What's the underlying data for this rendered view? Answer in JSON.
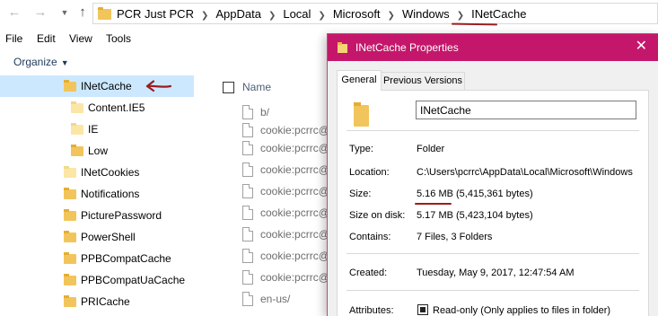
{
  "explorer": {
    "breadcrumbs": [
      "PCR Just PCR",
      "AppData",
      "Local",
      "Microsoft",
      "Windows",
      "INetCache"
    ],
    "menu": [
      "File",
      "Edit",
      "View",
      "Tools"
    ],
    "organize_label": "Organize",
    "nav_tree": [
      {
        "label": "INetCache",
        "selected": true,
        "pale": false
      },
      {
        "label": "Content.IE5",
        "selected": false,
        "pale": true
      },
      {
        "label": "IE",
        "selected": false,
        "pale": true
      },
      {
        "label": "Low",
        "selected": false,
        "pale": false
      },
      {
        "label": "INetCookies",
        "selected": false,
        "pale": true
      },
      {
        "label": "Notifications",
        "selected": false,
        "pale": false
      },
      {
        "label": "PicturePassword",
        "selected": false,
        "pale": false
      },
      {
        "label": "PowerShell",
        "selected": false,
        "pale": false
      },
      {
        "label": "PPBCompatCache",
        "selected": false,
        "pale": false
      },
      {
        "label": "PPBCompatUaCache",
        "selected": false,
        "pale": false
      },
      {
        "label": "PRICache",
        "selected": false,
        "pale": false
      }
    ],
    "column_header": "Name",
    "files": [
      "b/",
      "cookie:pcrrc@",
      "cookie:pcrrc@",
      "cookie:pcrrc@",
      "cookie:pcrrc@",
      "cookie:pcrrc@",
      "cookie:pcrrc@",
      "cookie:pcrrc@",
      "cookie:pcrrc@",
      "en-us/"
    ]
  },
  "properties": {
    "title": "INetCache Properties",
    "close_glyph": "✕",
    "tabs": [
      "General",
      "Previous Versions"
    ],
    "name_value": "INetCache",
    "rows": {
      "type": {
        "label": "Type:",
        "value": "Folder"
      },
      "location": {
        "label": "Location:",
        "value": "C:\\Users\\pcrrc\\AppData\\Local\\Microsoft\\Windows"
      },
      "size": {
        "label": "Size:",
        "value": "5.16 MB (5,415,361 bytes)"
      },
      "size_on_disk": {
        "label": "Size on disk:",
        "value": "5.17 MB (5,423,104 bytes)"
      },
      "contains": {
        "label": "Contains:",
        "value": "7 Files, 3 Folders"
      },
      "created": {
        "label": "Created:",
        "value": "Tuesday, May 9, 2017, 12:47:54 AM"
      },
      "attributes": {
        "label": "Attributes:",
        "value": "Read-only (Only applies to files in folder)"
      }
    }
  },
  "colors": {
    "titlebar": "#c4176b",
    "selection": "#cce8ff",
    "annotation": "#9c1d1d",
    "folder": "#f2c55c"
  }
}
